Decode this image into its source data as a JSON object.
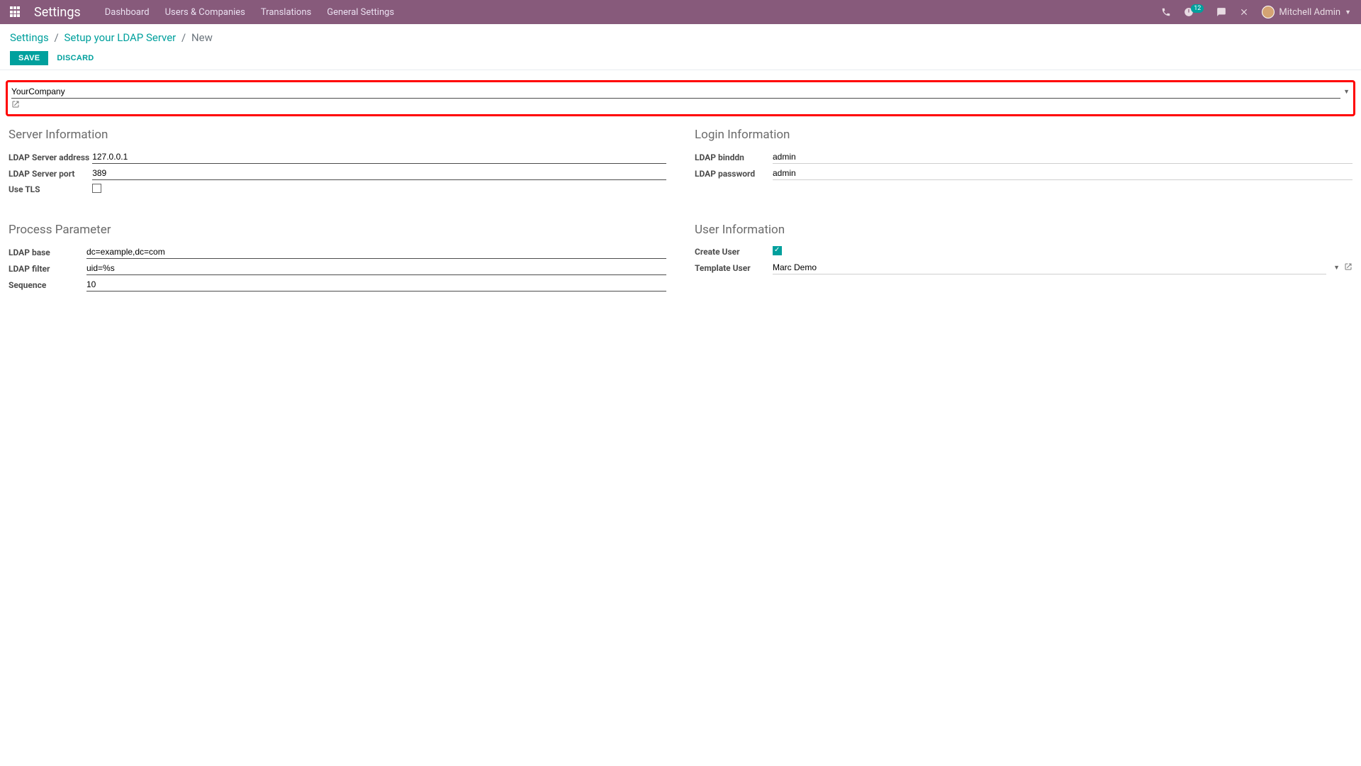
{
  "navbar": {
    "brand": "Settings",
    "menu": [
      "Dashboard",
      "Users & Companies",
      "Translations",
      "General Settings"
    ],
    "activity_count": "12",
    "user_name": "Mitchell Admin"
  },
  "breadcrumb": {
    "a": "Settings",
    "b": "Setup your LDAP Server",
    "c": "New"
  },
  "buttons": {
    "save": "Save",
    "discard": "Discard"
  },
  "company_field": {
    "value": "YourCompany"
  },
  "sections": {
    "server_info_title": "Server Information",
    "login_info_title": "Login Information",
    "process_param_title": "Process Parameter",
    "user_info_title": "User Information"
  },
  "fields": {
    "ldap_server_address": {
      "label": "LDAP Server address",
      "value": "127.0.0.1"
    },
    "ldap_server_port": {
      "label": "LDAP Server port",
      "value": "389"
    },
    "use_tls": {
      "label": "Use TLS",
      "checked": false
    },
    "ldap_binddn": {
      "label": "LDAP binddn",
      "value": "admin"
    },
    "ldap_password": {
      "label": "LDAP password",
      "value": "admin"
    },
    "ldap_base": {
      "label": "LDAP base",
      "value": "dc=example,dc=com"
    },
    "ldap_filter": {
      "label": "LDAP filter",
      "value": "uid=%s"
    },
    "sequence": {
      "label": "Sequence",
      "value": "10"
    },
    "create_user": {
      "label": "Create User",
      "checked": true
    },
    "template_user": {
      "label": "Template User",
      "value": "Marc Demo"
    }
  }
}
